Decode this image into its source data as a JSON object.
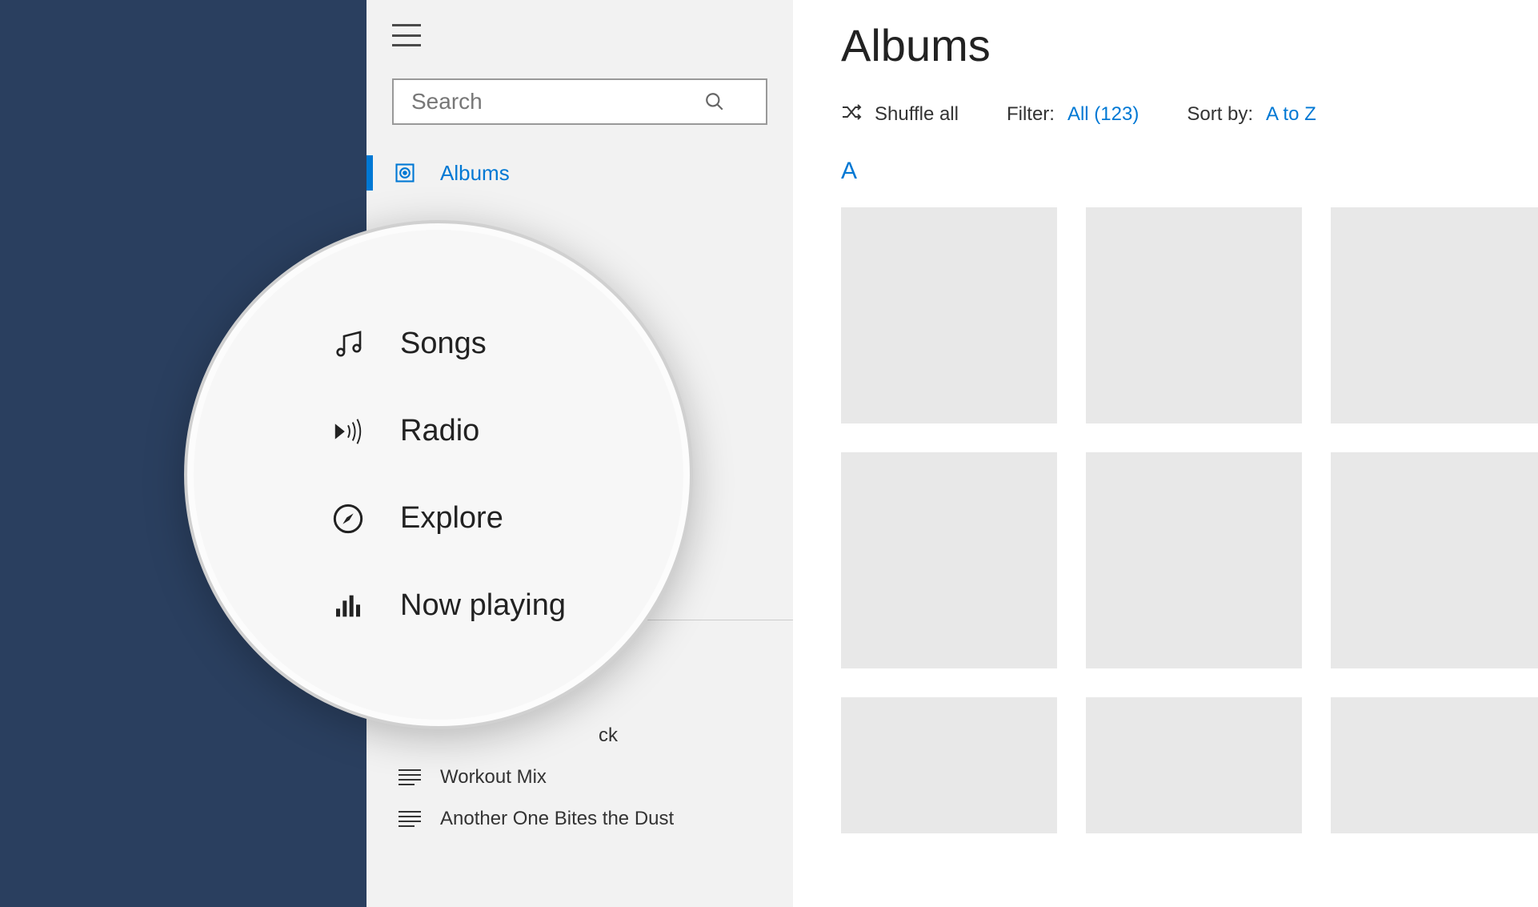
{
  "sidebar": {
    "search": {
      "placeholder": "Search"
    },
    "nav": {
      "albums": "Albums"
    },
    "magnified_nav": {
      "songs": "Songs",
      "radio": "Radio",
      "explore": "Explore",
      "now_playing": "Now playing"
    },
    "playlists": [
      {
        "label": "ck"
      },
      {
        "label": "Workout Mix"
      },
      {
        "label": "Another One Bites the Dust"
      }
    ]
  },
  "main": {
    "title": "Albums",
    "toolbar": {
      "shuffle": "Shuffle all",
      "filter_label": "Filter:",
      "filter_value": "All (123)",
      "sort_label": "Sort by:",
      "sort_value": "A to Z"
    },
    "section_letter": "A"
  },
  "colors": {
    "accent": "#0078d4",
    "sidebar_bg": "#f2f2f2",
    "bg_dark": "#2a3f5f"
  }
}
